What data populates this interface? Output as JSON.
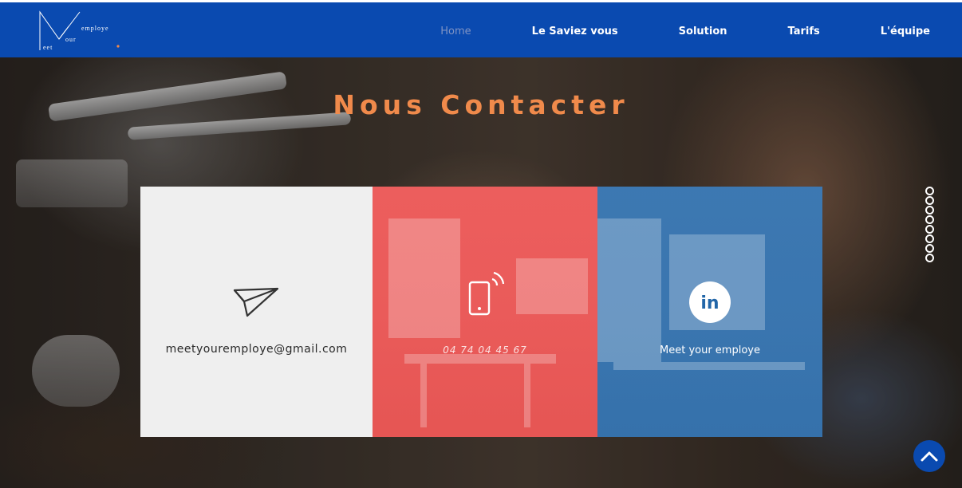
{
  "site": {
    "logo_word_top": "employe",
    "logo_word_mid": "our",
    "logo_word_bottom": "eet",
    "accent_color": "#f08a4b",
    "header_color": "#0a4ab0"
  },
  "nav": {
    "items": [
      {
        "label": "Home",
        "active": true
      },
      {
        "label": "Le Saviez vous",
        "active": false
      },
      {
        "label": "Solution",
        "active": false
      },
      {
        "label": "Tarifs",
        "active": false
      },
      {
        "label": "L'équipe",
        "active": false
      }
    ]
  },
  "heading": "Nous Contacter",
  "cards": {
    "email": {
      "icon": "paper-plane-icon",
      "text": "meetyouremploye@gmail.com",
      "color": "#efefef"
    },
    "phone": {
      "icon": "smartphone-signal-icon",
      "text": "04 74 04 45 67",
      "color": "#ed4848"
    },
    "linkedin": {
      "icon": "linkedin-icon",
      "icon_text": "in",
      "text": "Meet your employe",
      "color": "#2266a8"
    }
  },
  "page_dots": {
    "count": 8
  },
  "back_to_top": {
    "icon": "chevron-up-icon"
  }
}
